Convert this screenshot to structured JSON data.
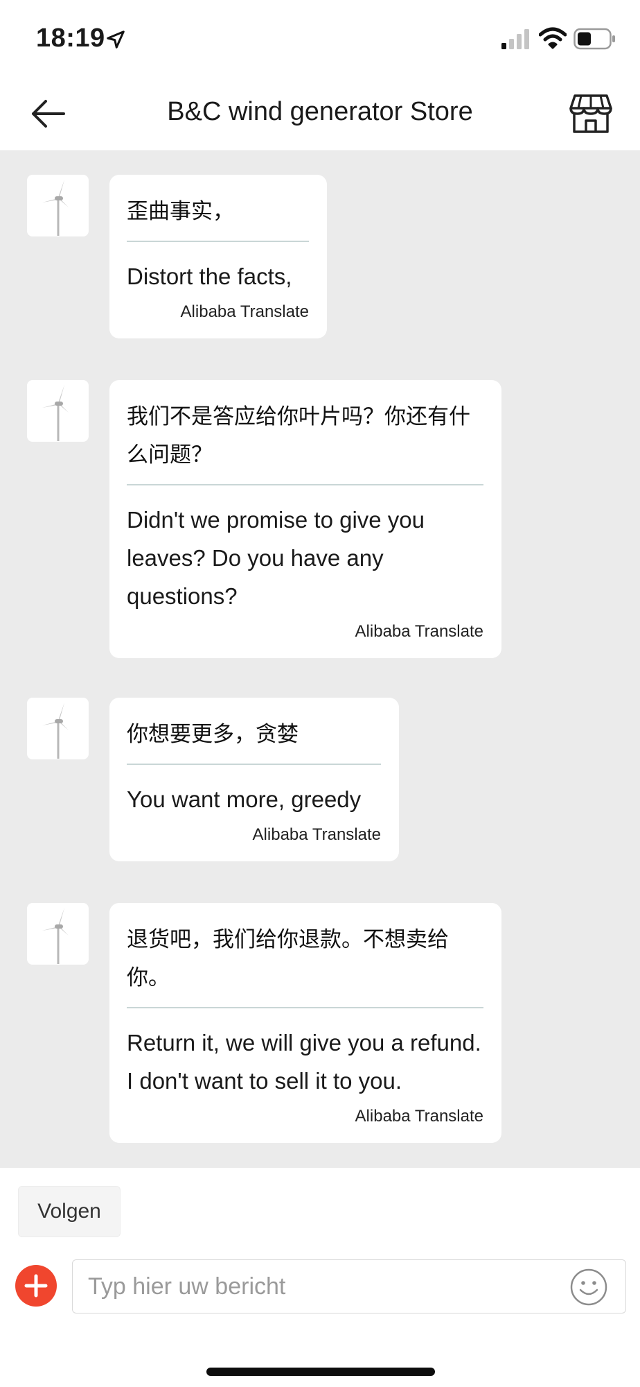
{
  "status_bar": {
    "time": "18:19",
    "icons": [
      "location-arrow-icon",
      "cellular-signal-icon",
      "wifi-icon",
      "battery-icon"
    ]
  },
  "header": {
    "title": "B&C wind generator Store",
    "back_icon": "arrow-left-icon",
    "store_icon": "storefront-icon"
  },
  "messages": [
    {
      "avatar_icon": "wind-turbine-icon",
      "original": "歪曲事实，",
      "translation": "Distort the facts,",
      "provider": "Alibaba Translate"
    },
    {
      "avatar_icon": "wind-turbine-icon",
      "original": "我们不是答应给你叶片吗？你还有什么问题？",
      "translation": "Didn't we promise to give you leaves? Do you have any questions?",
      "provider": "Alibaba Translate"
    },
    {
      "avatar_icon": "wind-turbine-icon",
      "original": "你想要更多，贪婪",
      "translation": "You want more, greedy",
      "provider": "Alibaba Translate"
    },
    {
      "avatar_icon": "wind-turbine-icon",
      "original": "退货吧，我们给你退款。不想卖给你。",
      "translation": "Return it, we will give you a refund. I don't want to sell it to you.",
      "provider": "Alibaba Translate"
    }
  ],
  "follow_button": {
    "label": "Volgen"
  },
  "composer": {
    "placeholder": "Typ hier uw bericht",
    "add_icon": "plus-circle-icon",
    "emoji_icon": "smiley-icon"
  },
  "colors": {
    "chat_background": "#ebebeb",
    "accent_red": "#f0462e",
    "bubble": "#ffffff"
  }
}
